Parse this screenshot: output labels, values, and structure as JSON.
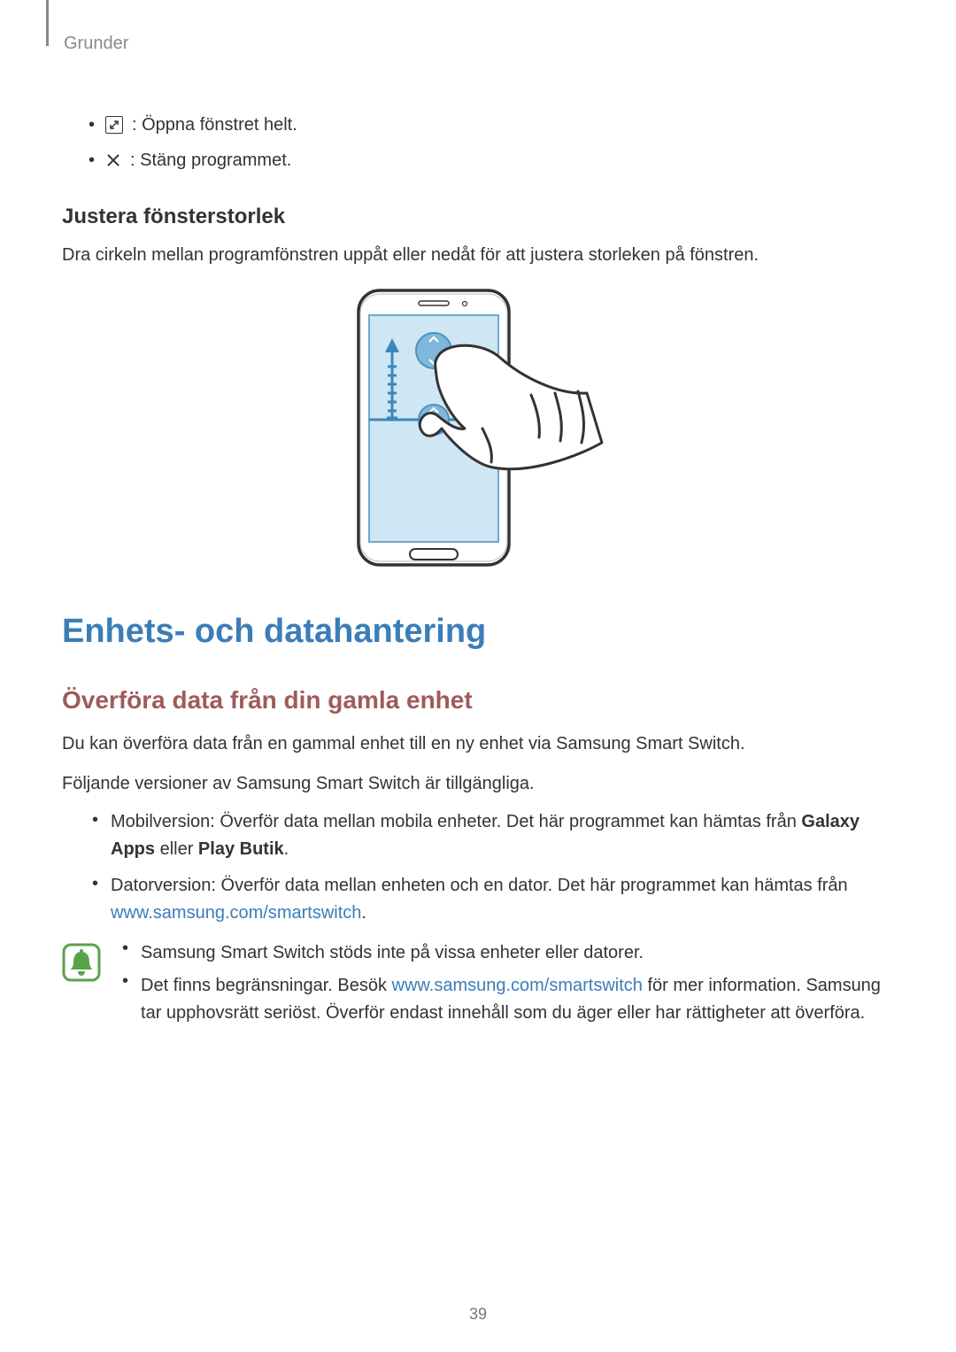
{
  "header": "Grunder",
  "icons": {
    "expand_desc": ": Öppna fönstret helt.",
    "close_desc": ": Stäng programmet."
  },
  "section1": {
    "heading": "Justera fönsterstorlek",
    "body": "Dra cirkeln mellan programfönstren uppåt eller nedåt för att justera storleken på fönstren."
  },
  "main_heading": "Enhets- och datahantering",
  "section2": {
    "heading": "Överföra data från din gamla enhet",
    "p1": "Du kan överföra data från en gammal enhet till en ny enhet via Samsung Smart Switch.",
    "p2": "Följande versioner av Samsung Smart Switch är tillgängliga.",
    "bullets": [
      {
        "pre": "Mobilversion: Överför data mellan mobila enheter. Det här programmet kan hämtas från ",
        "bold": "Galaxy Apps",
        "mid": " eller ",
        "bold2": "Play Butik",
        "post": "."
      },
      {
        "pre": "Datorversion: Överför data mellan enheten och en dator. Det här programmet kan hämtas från ",
        "link": "www.samsung.com/smartswitch",
        "post": "."
      }
    ],
    "note": [
      {
        "text": "Samsung Smart Switch stöds inte på vissa enheter eller datorer."
      },
      {
        "pre": "Det finns begränsningar. Besök ",
        "link": "www.samsung.com/smartswitch",
        "post": " för mer information. Samsung tar upphovsrätt seriöst. Överför endast innehåll som du äger eller har rättigheter att överföra."
      }
    ]
  },
  "page_number": "39"
}
